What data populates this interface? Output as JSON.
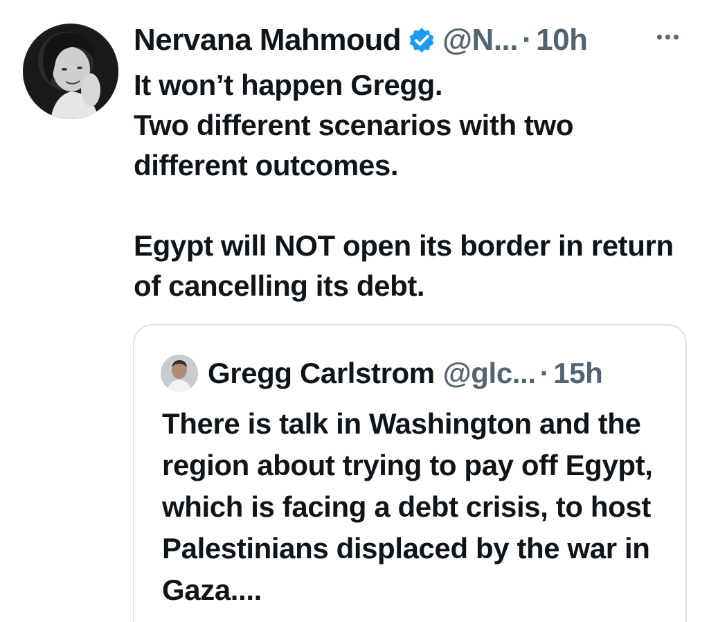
{
  "tweet": {
    "author": {
      "display_name": "Nervana Mahmoud",
      "handle": "@N...",
      "verified": true,
      "avatar_icon": "avatar-portrait"
    },
    "separator": "·",
    "time": "10h",
    "more_icon": "more-horizontal-icon",
    "text_lines": [
      "It won’t happen Gregg.",
      "Two different scenarios with two different outcomes.",
      "Egypt will NOT open its border in return of cancelling its debt."
    ]
  },
  "quoted_tweet": {
    "author": {
      "display_name": "Gregg Carlstrom",
      "handle": "@glc...",
      "avatar_icon": "avatar-portrait"
    },
    "separator": "·",
    "time": "15h",
    "text": "There is talk in Washington and the region about trying to pay off Egypt, which is facing a debt crisis, to host Palestinians displaced by the war in Gaza...."
  },
  "colors": {
    "text_primary": "#0f1419",
    "text_secondary": "#536471",
    "verified_blue": "#1d9bf0",
    "border": "#dfe3e6"
  }
}
